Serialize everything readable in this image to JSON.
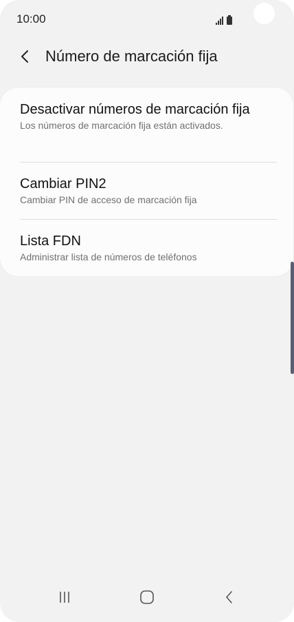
{
  "status_bar": {
    "time": "10:00"
  },
  "header": {
    "title": "Número de marcación fija"
  },
  "settings": {
    "items": [
      {
        "title": "Desactivar números de marcación fija",
        "subtitle": "Los números de marcación fija están activados."
      },
      {
        "title": "Cambiar PIN2",
        "subtitle": "Cambiar PIN de acceso de marcación fija"
      },
      {
        "title": "Lista FDN",
        "subtitle": "Administrar lista de números de teléfonos"
      }
    ]
  },
  "colors": {
    "background": "#f2f2f2",
    "card": "#fcfcfc",
    "scrollbar": "#5b5e70"
  },
  "icons": {
    "back": "chevron-left-icon",
    "recents": "recent-apps-icon",
    "home": "home-icon",
    "nav_back": "nav-back-icon"
  }
}
